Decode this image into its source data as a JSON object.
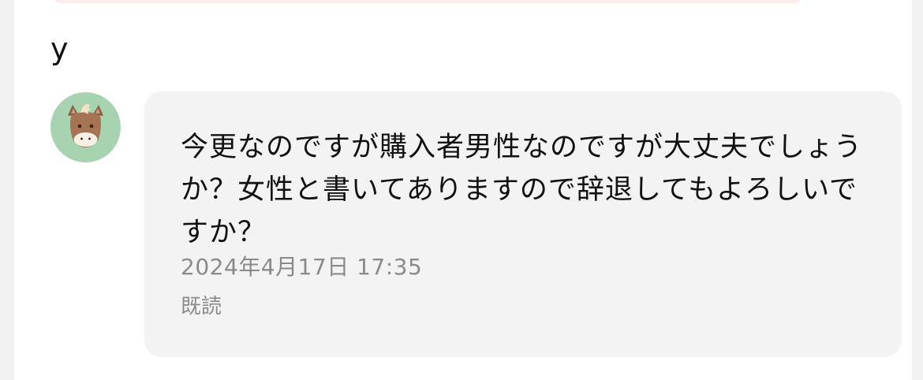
{
  "colors": {
    "page_background": "#f2f2f2",
    "card_background": "#ffffff",
    "message_bubble": "#f3f3f3",
    "previous_bubble": "#fdeced",
    "avatar_background": "#a7d3b0",
    "primary_text": "#111111",
    "secondary_text": "#8a8a8a"
  },
  "message": {
    "sender_name": "y",
    "avatar_icon": "horse-face-icon",
    "text": "今更なのですが購入者男性なのですが大丈夫でしょうか？女性と書いてありますので辞退してもよろしいですか？",
    "timestamp": "2024年4月17日 17:35",
    "read_status": "既読"
  }
}
